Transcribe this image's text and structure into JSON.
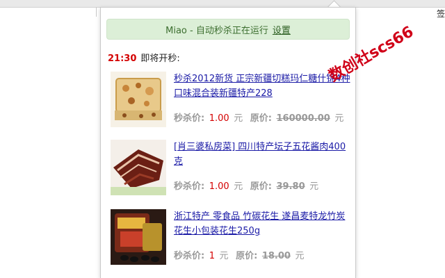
{
  "chrome": {
    "right_text": "签"
  },
  "popup": {
    "status": {
      "text": "Miao - 自动秒杀正在运行",
      "settings_link": "设置"
    },
    "schedule": {
      "time": "21:30",
      "label": "即将开秒:"
    },
    "price_labels": {
      "sale": "秒杀价:",
      "original": "原价:",
      "unit": "元"
    },
    "items": [
      {
        "title": "秒杀2012新货 正宗新疆切糕玛仁糖什锦4种口味混合装新疆特产228",
        "sale_price": "1.00",
        "original_price": "160000.00",
        "image": "nut-cake-icon"
      },
      {
        "title": "[肖三婆私房菜] 四川特产坛子五花酱肉400克",
        "sale_price": "1.00",
        "original_price": "39.80",
        "image": "cured-pork-icon"
      },
      {
        "title": "浙江特产 零食品 竹碳花生 遂昌麦特龙竹炭花生小包装花生250g",
        "sale_price": "1",
        "original_price": "18.00",
        "image": "peanut-snack-icon"
      }
    ]
  },
  "watermark": "数创社scs66",
  "colors": {
    "status_bg": "#dcefd7",
    "status_text": "#3c6e2f",
    "accent_red": "#d40000",
    "link": "#1a1aa6"
  }
}
